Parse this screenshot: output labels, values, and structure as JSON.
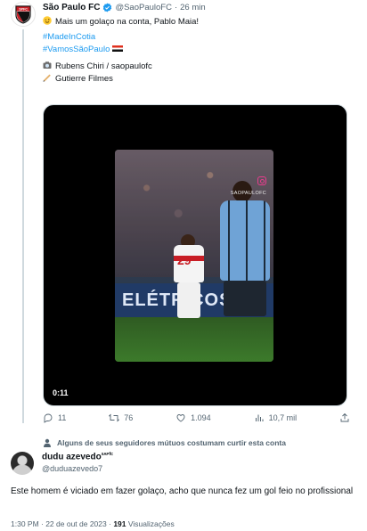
{
  "tweet1": {
    "author_name": "São Paulo FC",
    "handle": "@SaoPauloFC",
    "separator": "·",
    "time": "26 min",
    "text": "Mais um golaço na conta, Pablo Maia!",
    "hashtag1": "#MadeInCotia",
    "hashtag2": "#VamosSãoPaulo",
    "credit_photo": "Rubens Chiri / saopaulofc",
    "credit_film": "Gutierre Filmes",
    "video": {
      "board_text": "ELÉTRICOS",
      "watermark": "SAOPAULOFC",
      "duration": "0:11",
      "jersey_number": "29"
    },
    "actions": {
      "replies": "11",
      "retweets": "76",
      "likes": "1.094",
      "views": "10,7 mil"
    }
  },
  "social_context": "Alguns de seus seguidores mútuos costumam curtir esta conta",
  "tweet2": {
    "author_name": "dudu azevedo",
    "author_suffix": "sᴀᴘfᴄ",
    "handle": "@duduazevedo7",
    "text": "Este homem é viciado em fazer golaço, acho que nunca fez um gol feio no profissional",
    "timestamp": "1:30 PM · 22 de out de 2023 ·",
    "views_count": "191",
    "views_label": "Visualizações"
  },
  "colors": {
    "accent": "#1d9bf0",
    "muted": "#536471",
    "text": "#0f1419",
    "spfc_red": "#c81d25"
  },
  "icons": [
    "spfc-crest-icon",
    "verified-badge-icon",
    "wink-emoji-icon",
    "brazil-flag-icon",
    "camera-icon",
    "writing-hand-icon",
    "reply-icon",
    "retweet-icon",
    "like-icon",
    "views-icon",
    "share-icon",
    "person-icon"
  ]
}
